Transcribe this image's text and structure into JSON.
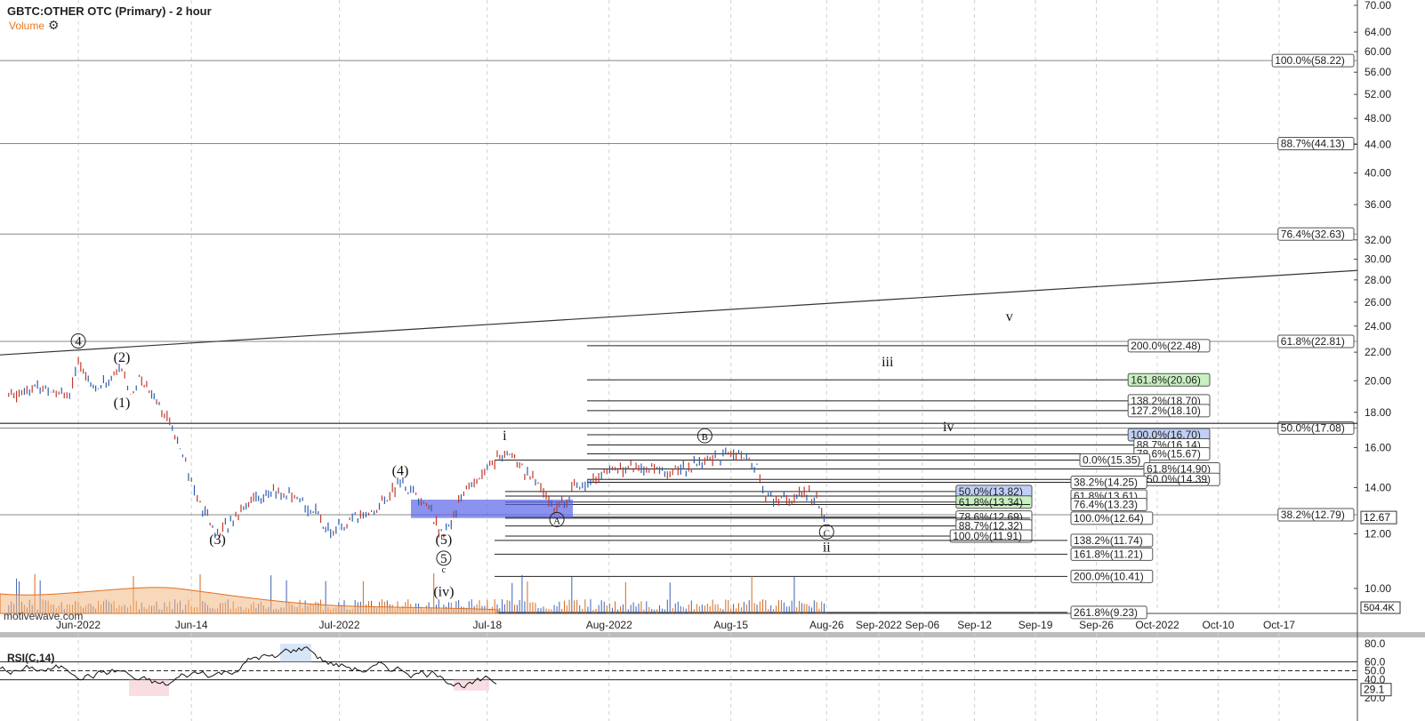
{
  "header": {
    "title": "GBTC:OTHER OTC (Primary) - 2 hour",
    "volume_label": "Volume",
    "settings_icon": "gear-icon",
    "watermark": "motivewave.com"
  },
  "chart_data": [
    {
      "type": "candlestick",
      "title": "GBTC:OTHER OTC (Primary) - 2 hour",
      "x_tick_labels": [
        "Jun-2022",
        "Jun-14",
        "Jul-2022",
        "Jul-18",
        "Aug-2022",
        "Aug-15",
        "Aug-26",
        "Sep-2022",
        "Sep-06",
        "Sep-12",
        "Sep-19",
        "Sep-26",
        "Oct-2022",
        "Oct-10",
        "Oct-17"
      ],
      "y_axis_scale": "log",
      "ylim": [
        9.2,
        70
      ],
      "y_tick_labels": [
        "10.00",
        "12.00",
        "14.00",
        "16.00",
        "18.00",
        "20.00",
        "22.00",
        "24.00",
        "26.00",
        "28.00",
        "30.00",
        "32.00",
        "36.00",
        "40.00",
        "44.00",
        "48.00",
        "52.00",
        "56.00",
        "60.00",
        "64.00",
        "70.00"
      ],
      "last_price_label": "12.67",
      "last_volume_label": "504.4K",
      "price_path": [
        {
          "date": "2022-05-24",
          "value": 19.0
        },
        {
          "date": "2022-05-27",
          "value": 19.6
        },
        {
          "date": "2022-05-31",
          "value": 19.2
        },
        {
          "date": "2022-06-01",
          "value": 21.2
        },
        {
          "date": "2022-06-03",
          "value": 19.4
        },
        {
          "date": "2022-06-06",
          "value": 20.8
        },
        {
          "date": "2022-06-07",
          "value": 19.1
        },
        {
          "date": "2022-06-08",
          "value": 20.2
        },
        {
          "date": "2022-06-10",
          "value": 18.8
        },
        {
          "date": "2022-06-13",
          "value": 15.8
        },
        {
          "date": "2022-06-14",
          "value": 14.2
        },
        {
          "date": "2022-06-15",
          "value": 13.2
        },
        {
          "date": "2022-06-17",
          "value": 11.9
        },
        {
          "date": "2022-06-20",
          "value": 13.2
        },
        {
          "date": "2022-06-22",
          "value": 13.6
        },
        {
          "date": "2022-06-24",
          "value": 13.8
        },
        {
          "date": "2022-06-28",
          "value": 13.0
        },
        {
          "date": "2022-06-30",
          "value": 12.0
        },
        {
          "date": "2022-07-05",
          "value": 13.0
        },
        {
          "date": "2022-07-08",
          "value": 14.2
        },
        {
          "date": "2022-07-11",
          "value": 13.2
        },
        {
          "date": "2022-07-13",
          "value": 11.8
        },
        {
          "date": "2022-07-15",
          "value": 13.6
        },
        {
          "date": "2022-07-18",
          "value": 15.0
        },
        {
          "date": "2022-07-20",
          "value": 15.8
        },
        {
          "date": "2022-07-22",
          "value": 15.0
        },
        {
          "date": "2022-07-26",
          "value": 13.0
        },
        {
          "date": "2022-07-28",
          "value": 14.0
        },
        {
          "date": "2022-08-02",
          "value": 15.0
        },
        {
          "date": "2022-08-08",
          "value": 14.8
        },
        {
          "date": "2022-08-12",
          "value": 15.2
        },
        {
          "date": "2022-08-15",
          "value": 15.8
        },
        {
          "date": "2022-08-18",
          "value": 15.0
        },
        {
          "date": "2022-08-19",
          "value": 13.6
        },
        {
          "date": "2022-08-22",
          "value": 13.4
        },
        {
          "date": "2022-08-24",
          "value": 13.8
        },
        {
          "date": "2022-08-26",
          "value": 12.7
        }
      ],
      "horizontal_levels": [
        {
          "label": "100.0%(58.22)",
          "value": 58.22
        },
        {
          "label": "88.7%(44.13)",
          "value": 44.13
        },
        {
          "label": "76.4%(32.63)",
          "value": 32.63
        },
        {
          "label": "61.8%(22.81)",
          "value": 22.81
        },
        {
          "label": "50.0%(17.08)",
          "value": 17.08
        },
        {
          "label": "38.2%(12.79)",
          "value": 12.79
        }
      ],
      "projection_levels": [
        {
          "label": "200.0%(22.48)",
          "value": 22.48
        },
        {
          "label": "161.8%(20.06)",
          "value": 20.06,
          "color": "#c8f0c0"
        },
        {
          "label": "138.2%(18.70)",
          "value": 18.7
        },
        {
          "label": "127.2%(18.10)",
          "value": 18.1
        },
        {
          "label": "100.0%(16.70)",
          "value": 16.7,
          "color": "#c0cff5"
        },
        {
          "label": "88.7%(16.14)",
          "value": 16.14
        },
        {
          "label": "78.6%(15.67)",
          "value": 15.67
        },
        {
          "label": "0.0%(15.35)",
          "value": 15.35
        },
        {
          "label": "61.8%(14.90)",
          "value": 14.9
        },
        {
          "label": "50.0%(14.39)",
          "value": 14.39
        },
        {
          "label": "38.2%(14.25)",
          "value": 14.25
        },
        {
          "label": "50.0%(13.82)",
          "value": 13.82,
          "color": "#c0cff5"
        },
        {
          "label": "61.8%(13.61)",
          "value": 13.61
        },
        {
          "label": "61.8%(13.34)",
          "value": 13.34,
          "color": "#c8f0c0"
        },
        {
          "label": "76.4%(13.23)",
          "value": 13.23
        },
        {
          "label": "78.6%(12.69)",
          "value": 12.69
        },
        {
          "label": "100.0%(12.64)",
          "value": 12.64
        },
        {
          "label": "88.7%(12.32)",
          "value": 12.32
        },
        {
          "label": "100.0%(11.91)",
          "value": 11.91
        },
        {
          "label": "138.2%(11.74)",
          "value": 11.74
        },
        {
          "label": "161.8%(11.21)",
          "value": 11.21
        },
        {
          "label": "200.0%(10.41)",
          "value": 10.41
        },
        {
          "label": "261.8%(9.23)",
          "value": 9.23
        }
      ],
      "wave_labels": [
        {
          "text": "4",
          "circled": true,
          "date": "2022-06-01",
          "value": 22.5
        },
        {
          "text": "(2)",
          "date": "2022-06-06",
          "value": 21.3
        },
        {
          "text": "(1)",
          "date": "2022-06-06",
          "value": 18.3
        },
        {
          "text": "(3)",
          "date": "2022-06-17",
          "value": 11.6
        },
        {
          "text": "(4)",
          "date": "2022-07-08",
          "value": 14.6
        },
        {
          "text": "(5)",
          "date": "2022-07-13",
          "value": 11.6
        },
        {
          "text": "5",
          "circled": true,
          "date": "2022-07-13",
          "value": 10.9
        },
        {
          "text": "c",
          "date": "2022-07-13",
          "value": 10.55
        },
        {
          "text": "(iv)",
          "date": "2022-07-13",
          "value": 9.75
        },
        {
          "text": "i",
          "date": "2022-07-20",
          "value": 16.4
        },
        {
          "text": "A",
          "circled": true,
          "date": "2022-07-26",
          "value": 12.4
        },
        {
          "text": "B",
          "circled": true,
          "date": "2022-08-12",
          "value": 16.4
        },
        {
          "text": "C",
          "circled": true,
          "date": "2022-08-26",
          "value": 11.9
        },
        {
          "text": "ii",
          "date": "2022-08-26",
          "value": 11.3
        },
        {
          "text": "iii",
          "date": "2022-09-02",
          "value": 21.0
        },
        {
          "text": "iv",
          "date": "2022-09-09",
          "value": 16.9
        },
        {
          "text": "v",
          "date": "2022-09-16",
          "value": 24.4
        }
      ]
    },
    {
      "type": "line",
      "title": "RSI(C,14)",
      "y_tick_labels": [
        "20.0",
        "40.0",
        "50.0",
        "60.0",
        "80.0"
      ],
      "levels": [
        60,
        50,
        40
      ],
      "last_value_label": "29.1",
      "ylim": [
        15,
        90
      ]
    }
  ]
}
